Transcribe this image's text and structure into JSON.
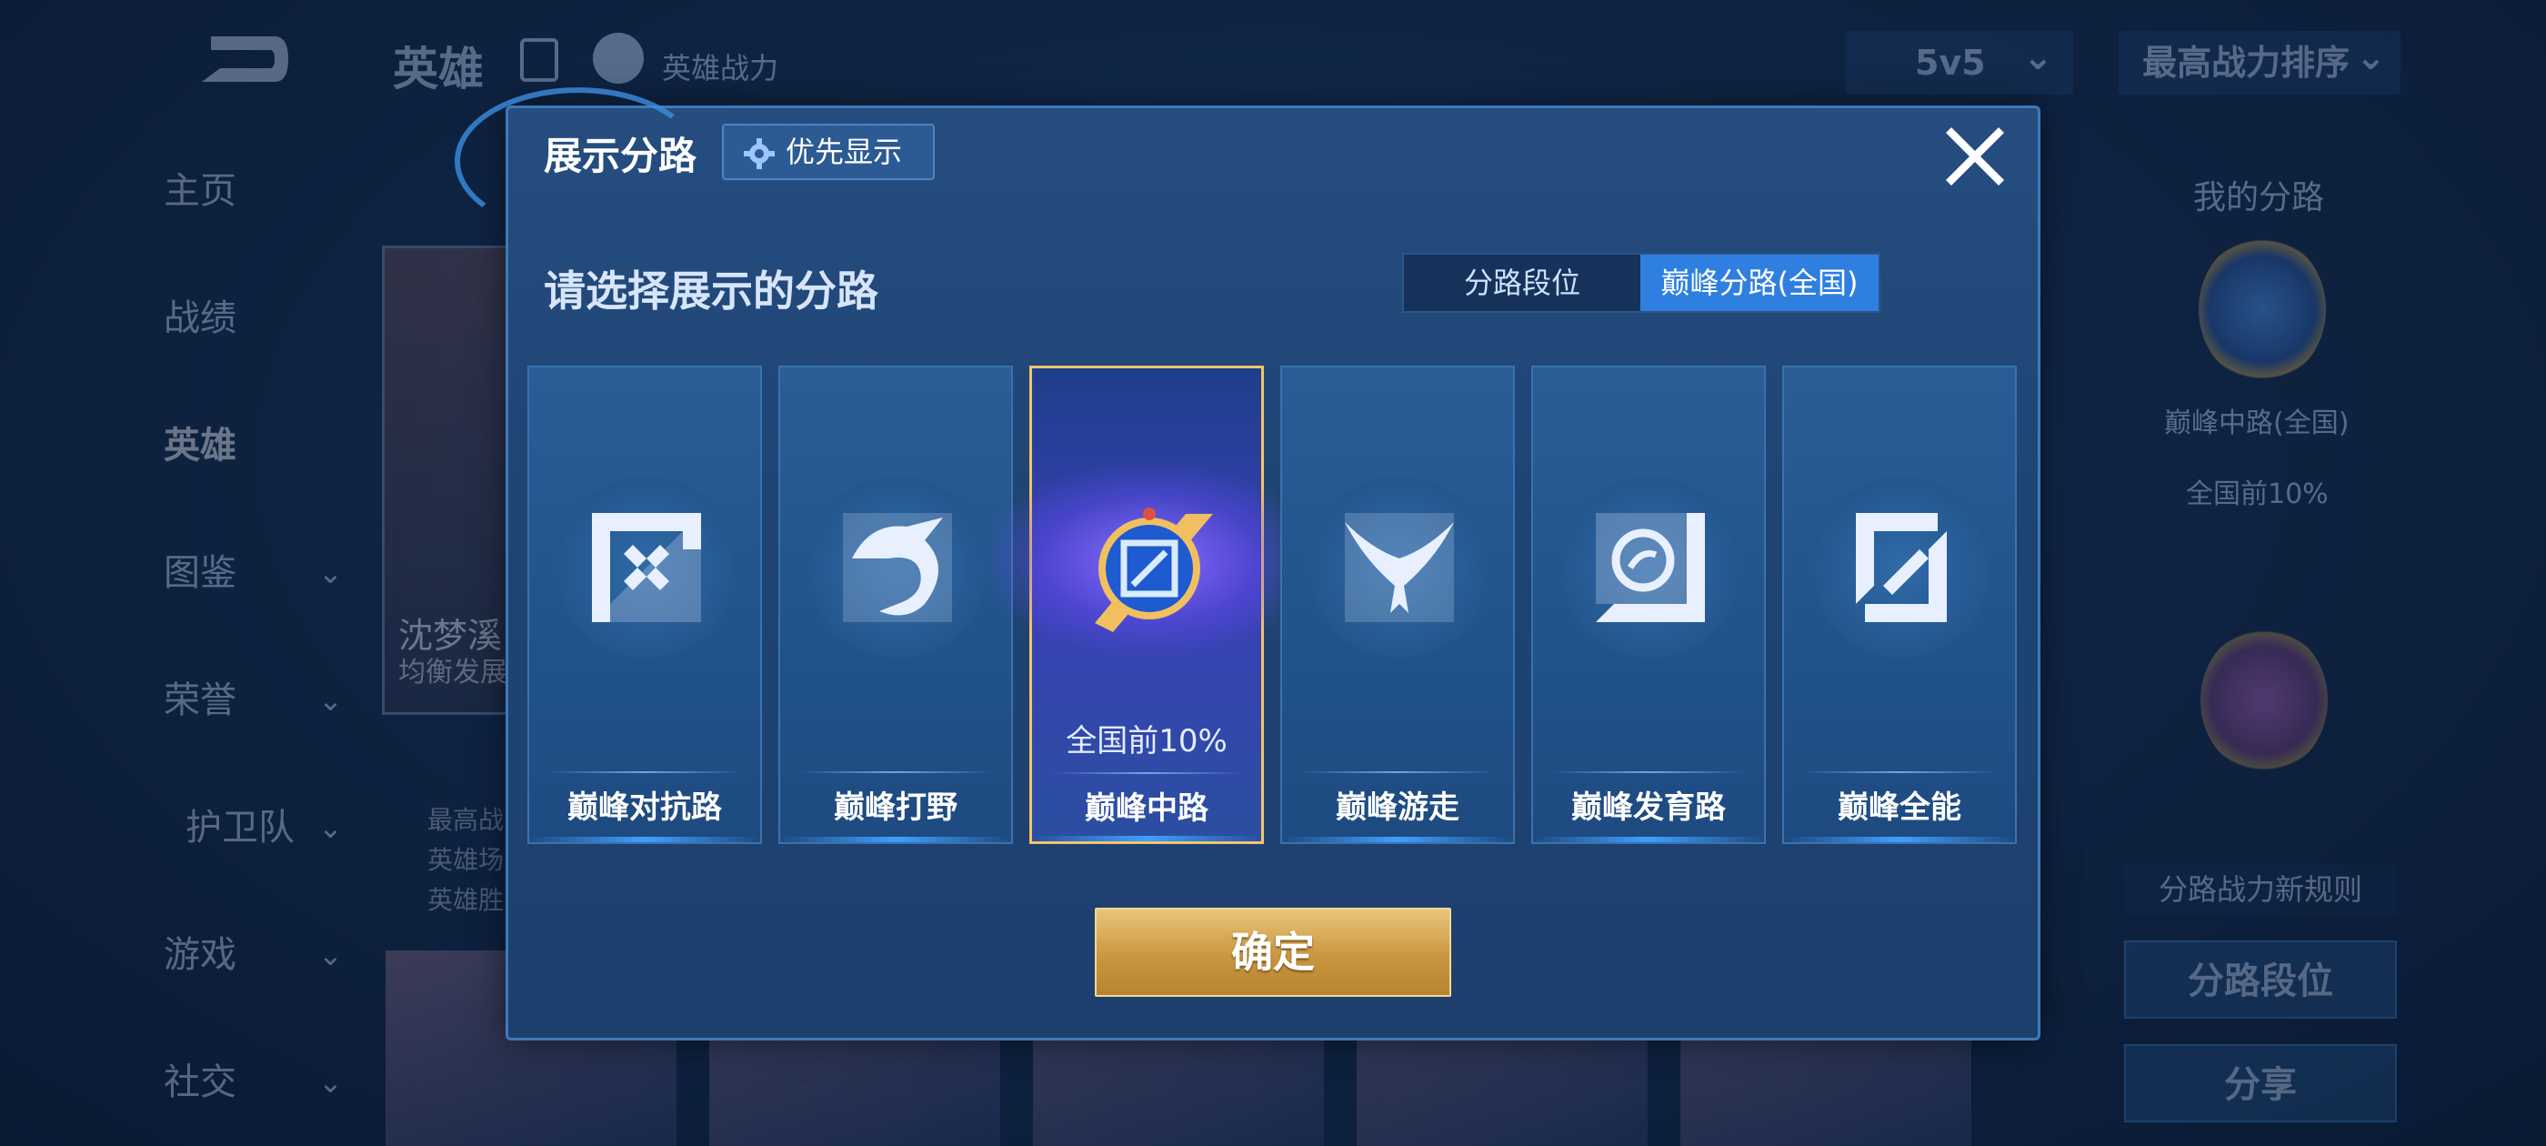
{
  "background": {
    "title": "英雄",
    "power_label": "英雄战力",
    "mode": "5v5",
    "sort": "最高战力排序",
    "nav": [
      {
        "label": "主页",
        "has_chevron": false
      },
      {
        "label": "战绩",
        "has_chevron": false
      },
      {
        "label": "英雄",
        "has_chevron": false,
        "active": true
      },
      {
        "label": "图鉴",
        "has_chevron": true
      },
      {
        "label": "荣誉",
        "has_chevron": true
      },
      {
        "label": "护卫队",
        "has_chevron": true
      },
      {
        "label": "游戏",
        "has_chevron": true
      },
      {
        "label": "社交",
        "has_chevron": true
      }
    ],
    "hero": {
      "name": "沈梦溪",
      "role": "均衡发展",
      "stats": [
        "最高战",
        "英雄场",
        "英雄胜"
      ]
    },
    "right_panel": {
      "title": "我的分路",
      "badge_name": "巅峰中路(全国)",
      "badge_rank": "全国前10%",
      "rule_label": "分路战力新规则",
      "buttons": [
        "分路段位",
        "分享"
      ]
    }
  },
  "modal": {
    "title": "展示分路",
    "priority_button": "优先显示",
    "subtitle": "请选择展示的分路",
    "toggle": {
      "options": [
        "分路段位",
        "巅峰分路(全国)"
      ],
      "selected": 1
    },
    "lanes": [
      {
        "label": "巅峰对抗路",
        "icon": "sword-lane-icon",
        "rank": ""
      },
      {
        "label": "巅峰打野",
        "icon": "dragon-jungle-icon",
        "rank": ""
      },
      {
        "label": "巅峰中路",
        "icon": "mid-lane-badge-icon",
        "rank": "全国前10%",
        "selected": true
      },
      {
        "label": "巅峰游走",
        "icon": "wings-support-icon",
        "rank": ""
      },
      {
        "label": "巅峰发育路",
        "icon": "marksman-lane-icon",
        "rank": ""
      },
      {
        "label": "巅峰全能",
        "icon": "allround-icon",
        "rank": ""
      }
    ],
    "confirm": "确定",
    "colors": {
      "accent": "#2f7fe0",
      "selected_border": "#f3c46b",
      "confirm_gold": "#c9973f"
    }
  }
}
